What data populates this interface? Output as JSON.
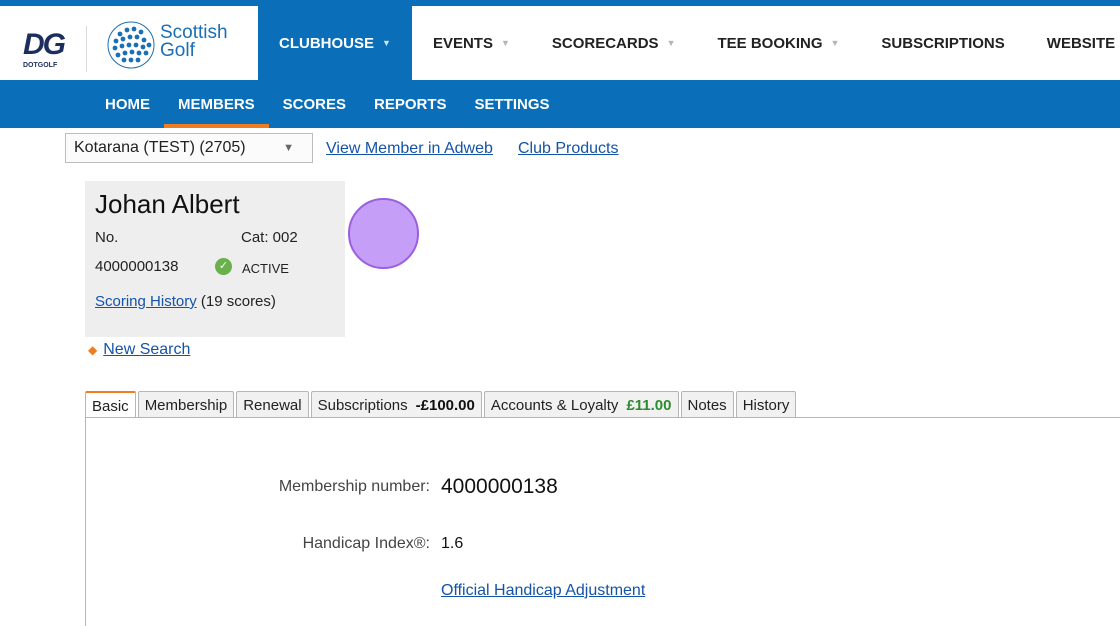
{
  "brand": {
    "dotgolf_mark": "DG",
    "dotgolf_text": "DOTGOLF",
    "scottish_golf_line1": "Scottish",
    "scottish_golf_line2": "Golf",
    "primary_color": "#0a6fb8",
    "accent_color": "#ee7d22"
  },
  "main_nav": {
    "items": [
      {
        "label": "CLUBHOUSE",
        "active": true,
        "has_caret": true
      },
      {
        "label": "EVENTS",
        "has_caret": true
      },
      {
        "label": "SCORECARDS",
        "has_caret": true
      },
      {
        "label": "TEE BOOKING",
        "has_caret": true
      },
      {
        "label": "SUBSCRIPTIONS",
        "has_caret": false
      },
      {
        "label": "WEBSITE",
        "has_caret": false
      }
    ],
    "caret_glyph": "▼"
  },
  "sub_nav": {
    "items": [
      {
        "label": "HOME"
      },
      {
        "label": "MEMBERS",
        "active": true
      },
      {
        "label": "SCORES"
      },
      {
        "label": "REPORTS"
      },
      {
        "label": "SETTINGS"
      }
    ]
  },
  "club_selector": {
    "value": "Kotarana (TEST) (2705)",
    "arrow_glyph": "▼"
  },
  "top_links": {
    "view_member": "View Member in Adweb",
    "club_products": "Club Products"
  },
  "member": {
    "name": "Johan Albert",
    "no_label": "No.",
    "category": "Cat: 002",
    "number": "4000000138",
    "status": "ACTIVE",
    "status_icon": "check-circle-icon",
    "scoring_history_link": "Scoring History",
    "scores_count": "(19 scores)"
  },
  "new_search": {
    "label": "New Search",
    "arrow_glyph": "◆",
    "arrow_icon": "arrow-left-icon"
  },
  "tabs": [
    {
      "label": "Basic",
      "active": true
    },
    {
      "label": "Membership"
    },
    {
      "label": "Renewal"
    },
    {
      "label": "Subscriptions",
      "amount": "-£100.00",
      "amount_type": "neg"
    },
    {
      "label": "Accounts & Loyalty",
      "amount": "£11.00",
      "amount_type": "pos"
    },
    {
      "label": "Notes"
    },
    {
      "label": "History"
    }
  ],
  "basic": {
    "membership_number_label": "Membership number:",
    "membership_number_value": "4000000138",
    "handicap_label": "Handicap Index®:",
    "handicap_value": "1.6",
    "adjustment_link": "Official Handicap Adjustment"
  },
  "cursor_marker_color": "#c59ef7"
}
